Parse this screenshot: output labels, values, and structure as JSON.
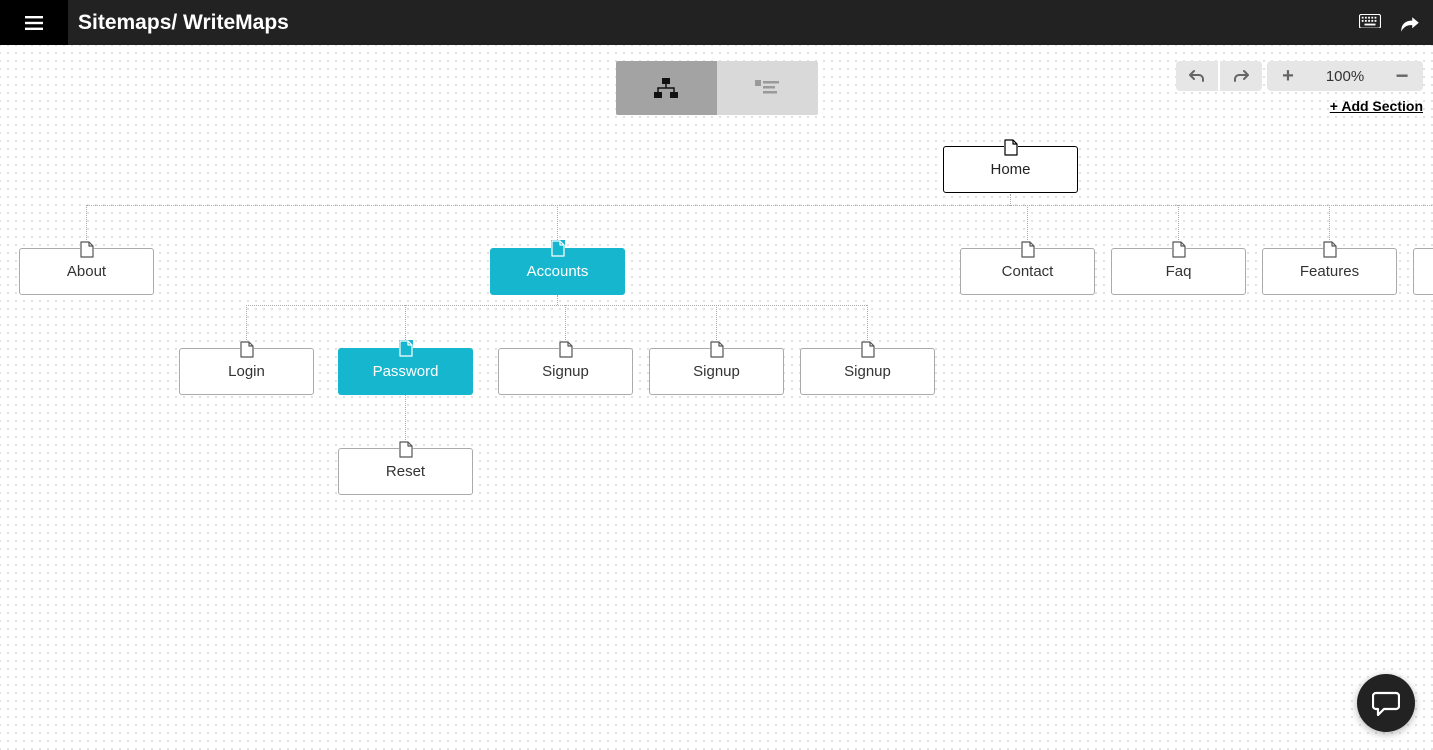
{
  "header": {
    "title": "Sitemaps/ WriteMaps"
  },
  "toolbar": {
    "zoom_label": "100%",
    "add_section_label": "+ Add Section"
  },
  "colors": {
    "accent": "#16b6cf"
  },
  "sitemap": {
    "root": {
      "label": "Home"
    },
    "level2": [
      {
        "label": "About"
      },
      {
        "label": "Accounts",
        "highlighted": true
      },
      {
        "label": "Contact"
      },
      {
        "label": "Faq"
      },
      {
        "label": "Features"
      }
    ],
    "accounts_children": [
      {
        "label": "Login"
      },
      {
        "label": "Password",
        "highlighted": true
      },
      {
        "label": "Signup"
      },
      {
        "label": "Signup"
      },
      {
        "label": "Signup"
      }
    ],
    "password_children": [
      {
        "label": "Reset"
      }
    ]
  }
}
